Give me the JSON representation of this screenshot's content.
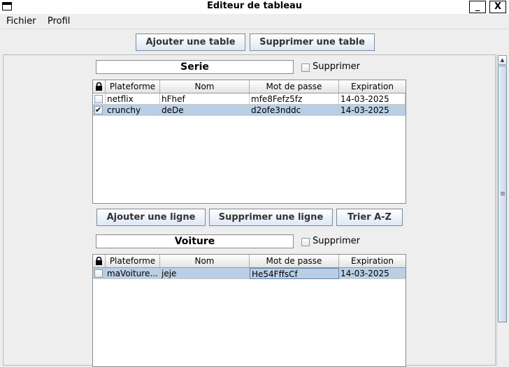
{
  "window": {
    "title": "Editeur de tableau",
    "minimize": "_",
    "close": "X"
  },
  "menubar": {
    "items": [
      "Fichier",
      "Profil"
    ]
  },
  "toolbar": {
    "add_table": "Ajouter une table",
    "delete_table": "Supprimer une table"
  },
  "tables": [
    {
      "name": "Serie",
      "delete_label": "Supprimer",
      "delete_checked": false,
      "columns": [
        "Plateforme",
        "Nom",
        "Mot de passe",
        "Expiration"
      ],
      "rows": [
        {
          "checked": false,
          "selected": false,
          "cells": [
            "netflix",
            "hFhef",
            "mfe8Fefz5fz",
            "14-03-2025"
          ]
        },
        {
          "checked": true,
          "selected": true,
          "cells": [
            "crunchy",
            "deDe",
            "d2ofe3nddc",
            "14-03-2025"
          ]
        }
      ],
      "actions": {
        "add_row": "Ajouter une ligne",
        "delete_row": "Supprimer une ligne",
        "sort": "Trier A-Z"
      }
    },
    {
      "name": "Voiture",
      "delete_label": "Supprimer",
      "delete_checked": false,
      "columns": [
        "Plateforme",
        "Nom",
        "Mot de passe",
        "Expiration"
      ],
      "rows": [
        {
          "checked": false,
          "selected": true,
          "cells": [
            "maVoiture...",
            "jeje",
            "He54FffsCf",
            "14-03-2025"
          ]
        }
      ]
    }
  ],
  "colors": {
    "selection": "#b8cfe5",
    "button_border": "#7a8a99"
  }
}
